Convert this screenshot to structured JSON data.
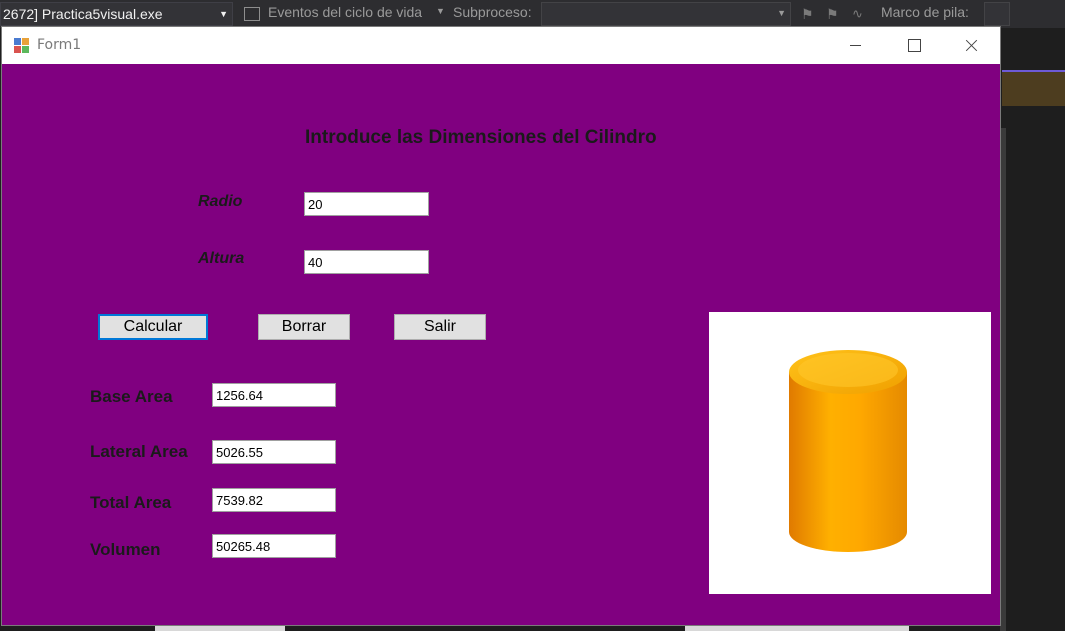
{
  "vs": {
    "process": "2672] Practica5visual.exe",
    "lifecycle_events": "Eventos del ciclo de vida",
    "thread_label": "Subproceso:",
    "thread_value": "",
    "stack_label": "Marco de pila:"
  },
  "form": {
    "title": "Form1",
    "heading": "Introduce las Dimensiones del Cilindro",
    "radio_label": "Radio",
    "radio_value": "20",
    "altura_label": "Altura",
    "altura_value": "40",
    "buttons": {
      "calcular": "Calcular",
      "borrar": "Borrar",
      "salir": "Salir"
    },
    "results": {
      "base_area_label": "Base Area",
      "base_area_value": "1256.64",
      "lateral_area_label": "Lateral Area",
      "lateral_area_value": "5026.55",
      "total_area_label": "Total Area",
      "total_area_value": "7539.82",
      "volumen_label": "Volumen",
      "volumen_value": "50265.48"
    }
  },
  "colors": {
    "form_background": "#800080",
    "cylinder_body": "#ffa500",
    "focus_border": "#0078d7"
  }
}
